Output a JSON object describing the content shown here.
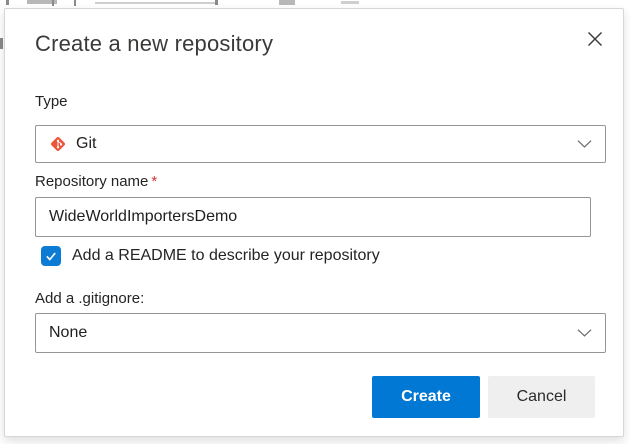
{
  "dialog": {
    "title": "Create a new repository"
  },
  "form": {
    "type": {
      "label": "Type",
      "value": "Git",
      "icon": "git-logo"
    },
    "repository_name": {
      "label": "Repository name",
      "required_marker": "*",
      "value": "WideWorldImportersDemo"
    },
    "readme": {
      "label": "Add a README to describe your repository",
      "checked": true
    },
    "gitignore": {
      "label": "Add a .gitignore:",
      "value": "None"
    }
  },
  "footer": {
    "create_label": "Create",
    "cancel_label": "Cancel"
  },
  "colors": {
    "accent": "#0078d4",
    "checkbox": "#0c7bd4",
    "git_icon": "#ef5339",
    "required_marker": "#d13438",
    "cancel_background": "#efefef",
    "field_border": "#979593",
    "title_text": "#3b3a39"
  }
}
